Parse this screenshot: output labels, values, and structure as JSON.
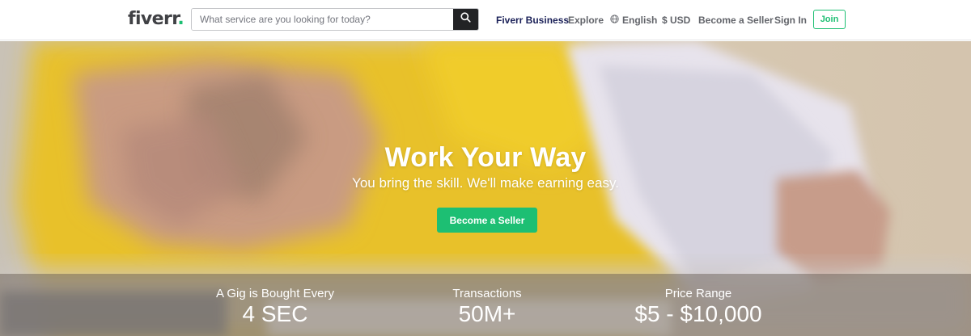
{
  "header": {
    "logo_text": "fiverr",
    "logo_dot": ".",
    "search_placeholder": "What service are you looking for today?",
    "nav": {
      "business": "Fiverr Business",
      "explore": "Explore",
      "language": "English",
      "currency": "$ USD",
      "become_seller": "Become a Seller",
      "sign_in": "Sign In",
      "join": "Join"
    }
  },
  "hero": {
    "title": "Work Your Way",
    "subtitle": "You bring the skill. We'll make earning easy.",
    "cta": "Become a Seller"
  },
  "stats": [
    {
      "label": "A Gig is Bought Every",
      "value": "4 SEC"
    },
    {
      "label": "Transactions",
      "value": "50M+"
    },
    {
      "label": "Price Range",
      "value": "$5 - $10,000"
    }
  ],
  "colors": {
    "brand_green": "#1dbf73",
    "business_navy": "#1a2058",
    "search_button": "#222325"
  },
  "icons": {
    "search": "search-icon",
    "globe": "globe-icon"
  }
}
